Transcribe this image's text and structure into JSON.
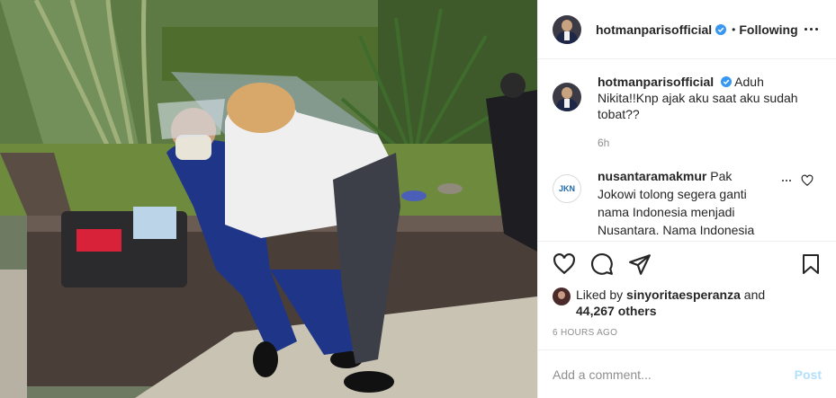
{
  "header": {
    "username": "hotmanparisofficial",
    "separator": "•",
    "follow_state": "Following"
  },
  "caption": {
    "username": "hotmanparisofficial",
    "text": "Aduh Nikita!!Knp ajak aku saat aku sudah tobat??",
    "time": "6h"
  },
  "comments": [
    {
      "avatar_label": "JKN",
      "username": "nusantaramakmur",
      "text": "Pak Jokowi tolong segera ganti nama Indonesia menjadi Nusantara. Nama Indonesia membawa"
    }
  ],
  "likes": {
    "prefix": "Liked by",
    "liker": "sinyoritaesperanza",
    "and": "and",
    "others": "44,267 others"
  },
  "timestamp": "6 HOURS AGO",
  "add_comment": {
    "placeholder": "Add a comment...",
    "post_label": "Post"
  },
  "colors": {
    "verified": "#3897f0",
    "post_disabled": "#b2dffc",
    "muted": "#8e8e8e"
  },
  "icons": [
    "verified-badge-icon",
    "more-options-icon",
    "heart-icon",
    "comment-icon",
    "share-icon",
    "bookmark-icon"
  ]
}
